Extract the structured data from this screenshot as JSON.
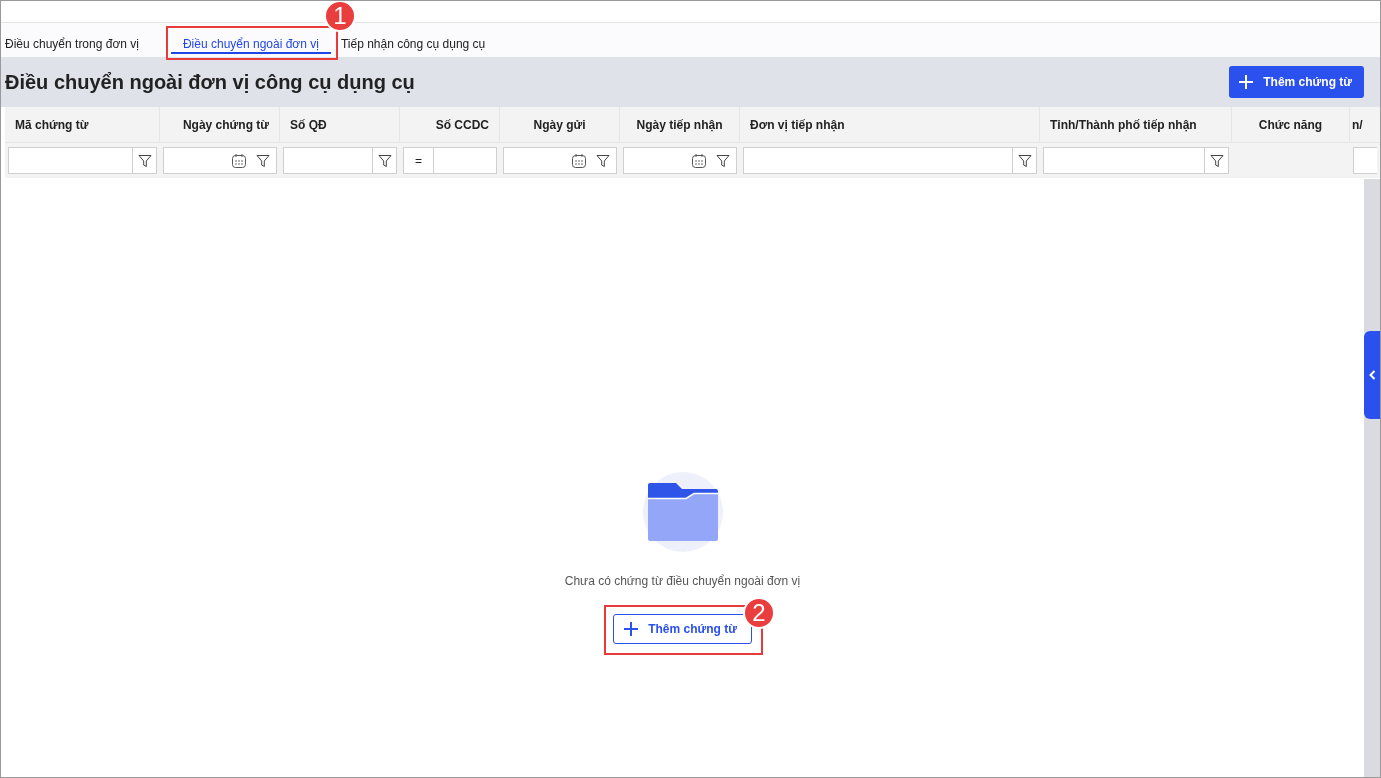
{
  "tabs": [
    {
      "label": "Điều chuyển trong đơn vị",
      "selected": false
    },
    {
      "label": "Điều chuyển ngoài đơn vị",
      "selected": true
    },
    {
      "label": "Tiếp nhận công cụ dụng cụ",
      "selected": false
    }
  ],
  "page_title": "Điều chuyển ngoài đơn vị công cụ dụng cụ",
  "add_button": "Thêm chứng từ",
  "table": {
    "columns": [
      {
        "label": "Mã chứng từ",
        "kind": "text"
      },
      {
        "label": "Ngày chứng từ",
        "kind": "date"
      },
      {
        "label": "Số QĐ",
        "kind": "text"
      },
      {
        "label": "Số CCDC",
        "kind": "number"
      },
      {
        "label": "Ngày gửi",
        "kind": "date"
      },
      {
        "label": "Ngày tiếp nhận",
        "kind": "date"
      },
      {
        "label": "Đơn vị tiếp nhận",
        "kind": "text"
      },
      {
        "label": "Tỉnh/Thành phố tiếp nhận",
        "kind": "text"
      },
      {
        "label": "Chức năng",
        "kind": "none"
      },
      {
        "label": "n/",
        "kind": "cut"
      }
    ],
    "number_operator": "="
  },
  "empty_state": {
    "message": "Chưa có chứng từ điều chuyển ngoài đơn vị",
    "button": "Thêm chứng từ"
  },
  "annotations": [
    {
      "label": "1"
    },
    {
      "label": "2"
    }
  ]
}
